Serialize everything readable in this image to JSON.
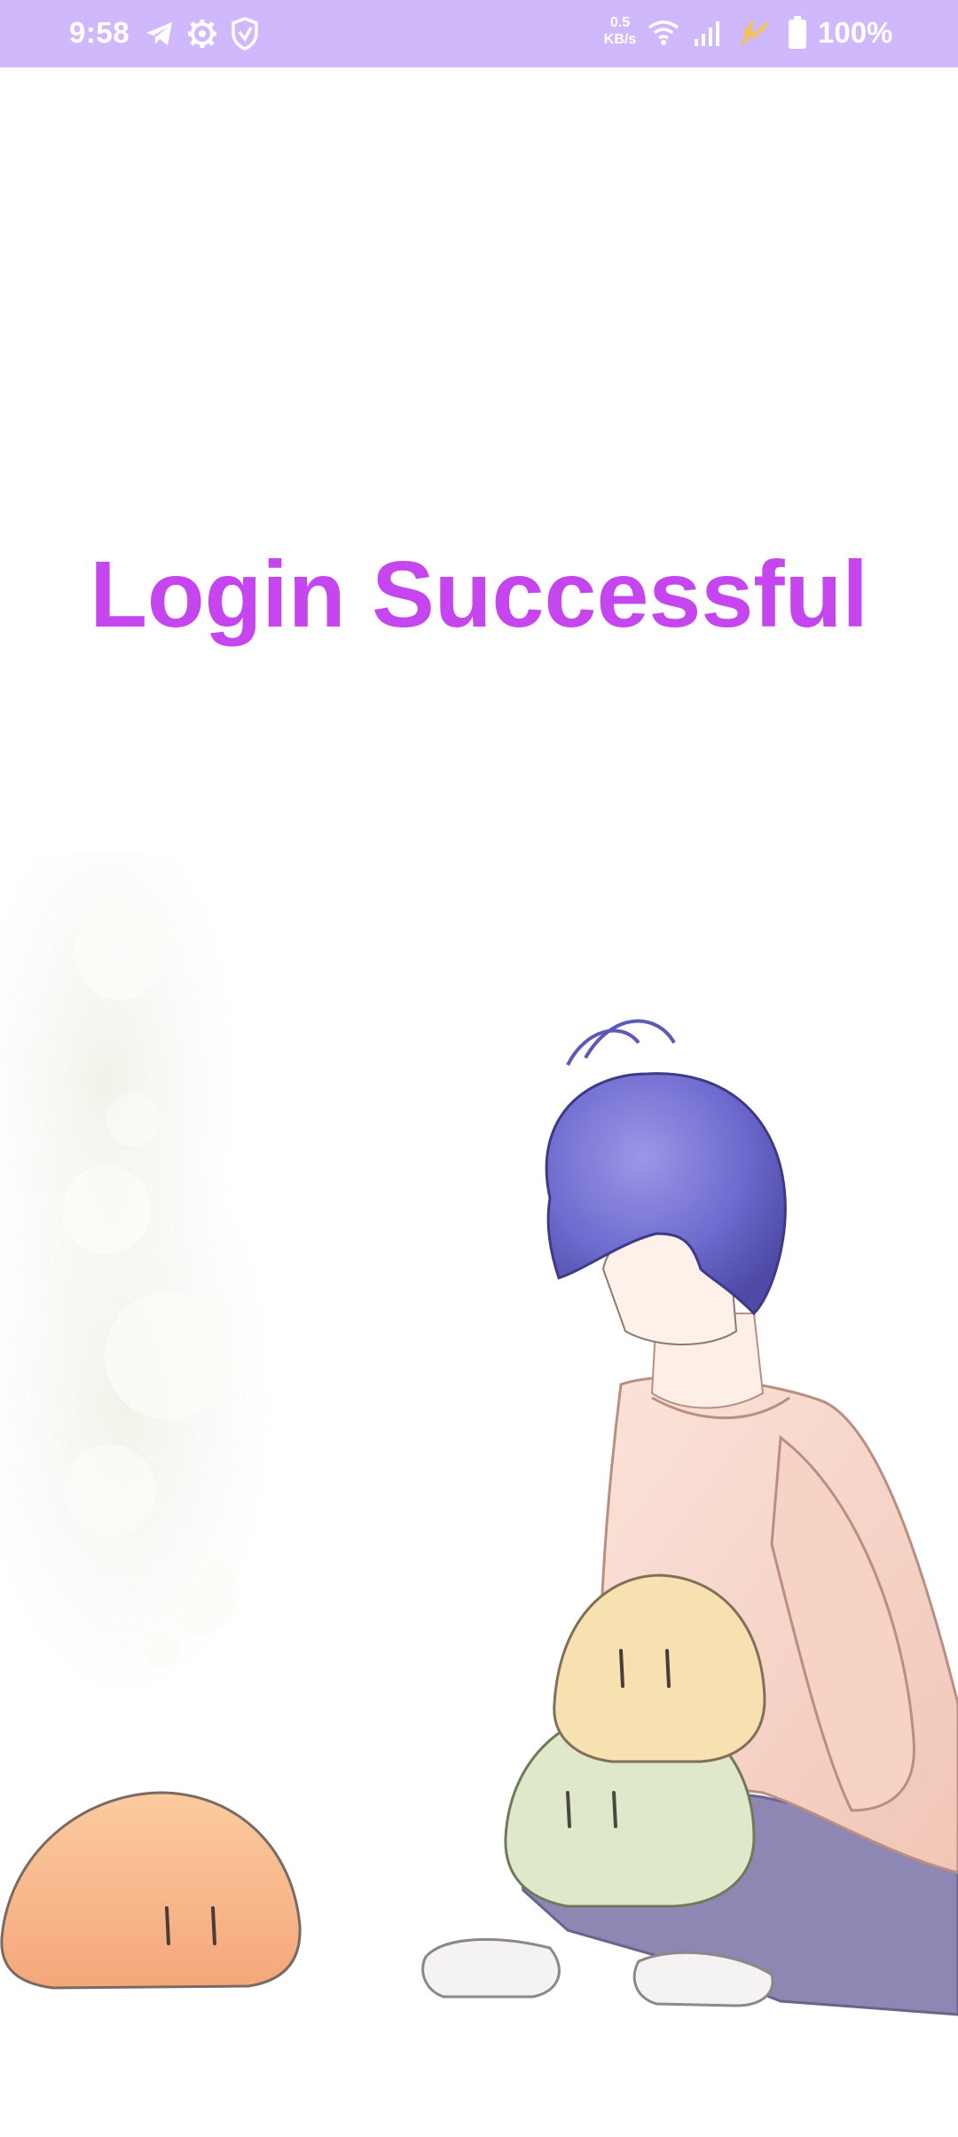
{
  "status_bar": {
    "time": "9:58",
    "net_speed_value": "0.5",
    "net_speed_unit": "KB/s",
    "battery_percent": "100%",
    "icons": [
      "telegram-icon",
      "settings-gear-icon",
      "vpn-shield-icon",
      "wifi-icon",
      "signal-icon",
      "charging-bolt-icon",
      "battery-icon"
    ]
  },
  "main": {
    "title": "Login Successful"
  },
  "colors": {
    "status_bar_bg": "#cfb8fb",
    "title": "#c545ef",
    "background": "#ffffff"
  }
}
